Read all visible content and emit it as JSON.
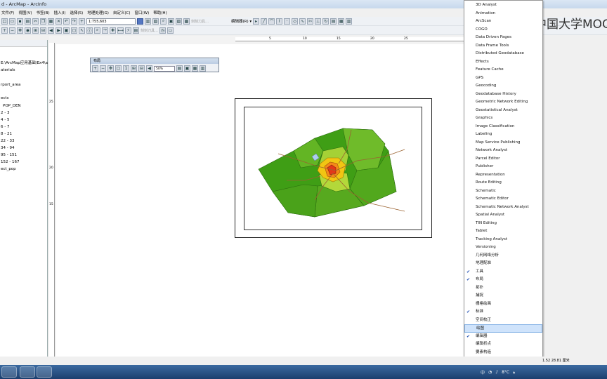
{
  "window": {
    "title": "d - ArcMap - ArcInfo"
  },
  "menubar": [
    "文件(F)",
    "视图(V)",
    "书签(B)",
    "插入(I)",
    "选择(S)",
    "地理处理(G)",
    "自定义(C)",
    "窗口(W)",
    "帮助(H)"
  ],
  "toolbar": {
    "scale": "1:755,603",
    "editor_label": "编辑器(R) ▾",
    "sketch_label": "刻刻刀具…"
  },
  "toc": {
    "items": [
      "E:\\ArcMap应用基础\\Ex4\\a",
      "aterials",
      "rport_area",
      "ects",
      "POP_DEN",
      "2 - 3",
      "4 - 5",
      "6 - 7",
      "8 - 21",
      "22 - 33",
      "34 - 94",
      "95 - 151",
      "152 - 167",
      "ect_pop"
    ]
  },
  "layout_toolbar": {
    "title": "布局",
    "zoom": "50%"
  },
  "rulers": {
    "h": [
      "5",
      "10",
      "15",
      "20",
      "25"
    ],
    "v": [
      "25",
      "20",
      "15"
    ]
  },
  "context_menu": {
    "items": [
      {
        "label": "3D Analyst",
        "checked": false
      },
      {
        "label": "Animation",
        "checked": false
      },
      {
        "label": "ArcScan",
        "checked": false
      },
      {
        "label": "COGO",
        "checked": false
      },
      {
        "label": "Data Driven Pages",
        "checked": false
      },
      {
        "label": "Data Frame Tools",
        "checked": false
      },
      {
        "label": "Distributed Geodatabase",
        "checked": false
      },
      {
        "label": "Effects",
        "checked": false
      },
      {
        "label": "Feature Cache",
        "checked": false
      },
      {
        "label": "GPS",
        "checked": false
      },
      {
        "label": "Geocoding",
        "checked": false
      },
      {
        "label": "Geodatabase History",
        "checked": false
      },
      {
        "label": "Geometric Network Editing",
        "checked": false
      },
      {
        "label": "Geostatistical Analyst",
        "checked": false
      },
      {
        "label": "Graphics",
        "checked": false
      },
      {
        "label": "Image Classification",
        "checked": false
      },
      {
        "label": "Labeling",
        "checked": false
      },
      {
        "label": "Map Service Publishing",
        "checked": false
      },
      {
        "label": "Network Analyst",
        "checked": false
      },
      {
        "label": "Parcel Editor",
        "checked": false
      },
      {
        "label": "Publisher",
        "checked": false
      },
      {
        "label": "Representation",
        "checked": false
      },
      {
        "label": "Route Editing",
        "checked": false
      },
      {
        "label": "Schematic",
        "checked": false
      },
      {
        "label": "Schematic Editor",
        "checked": false
      },
      {
        "label": "Schematic Network Analyst",
        "checked": false
      },
      {
        "label": "Spatial Analyst",
        "checked": false
      },
      {
        "label": "TIN Editing",
        "checked": false
      },
      {
        "label": "Tablet",
        "checked": false
      },
      {
        "label": "Tracking Analyst",
        "checked": false
      },
      {
        "label": "Versioning",
        "checked": false
      },
      {
        "label": "几何网络分析",
        "checked": false
      },
      {
        "label": "地理配准",
        "checked": false
      },
      {
        "label": "工具",
        "checked": true
      },
      {
        "label": "布局",
        "checked": true
      },
      {
        "label": "拓扑",
        "checked": false
      },
      {
        "label": "捕捉",
        "checked": false
      },
      {
        "label": "栅格绘画",
        "checked": false
      },
      {
        "label": "标准",
        "checked": true
      },
      {
        "label": "空间校正",
        "checked": false
      },
      {
        "label": "绘图",
        "checked": false,
        "highlighted": true
      },
      {
        "label": "编辑器",
        "checked": true
      },
      {
        "label": "编辑折点",
        "checked": false
      },
      {
        "label": "要素构造",
        "checked": false
      }
    ],
    "more": "▾"
  },
  "watermark": {
    "text": "中国大学MOOC"
  },
  "status": {
    "coords": "1.52   28.81 厘米"
  },
  "tray": {
    "temp": "8°C"
  }
}
